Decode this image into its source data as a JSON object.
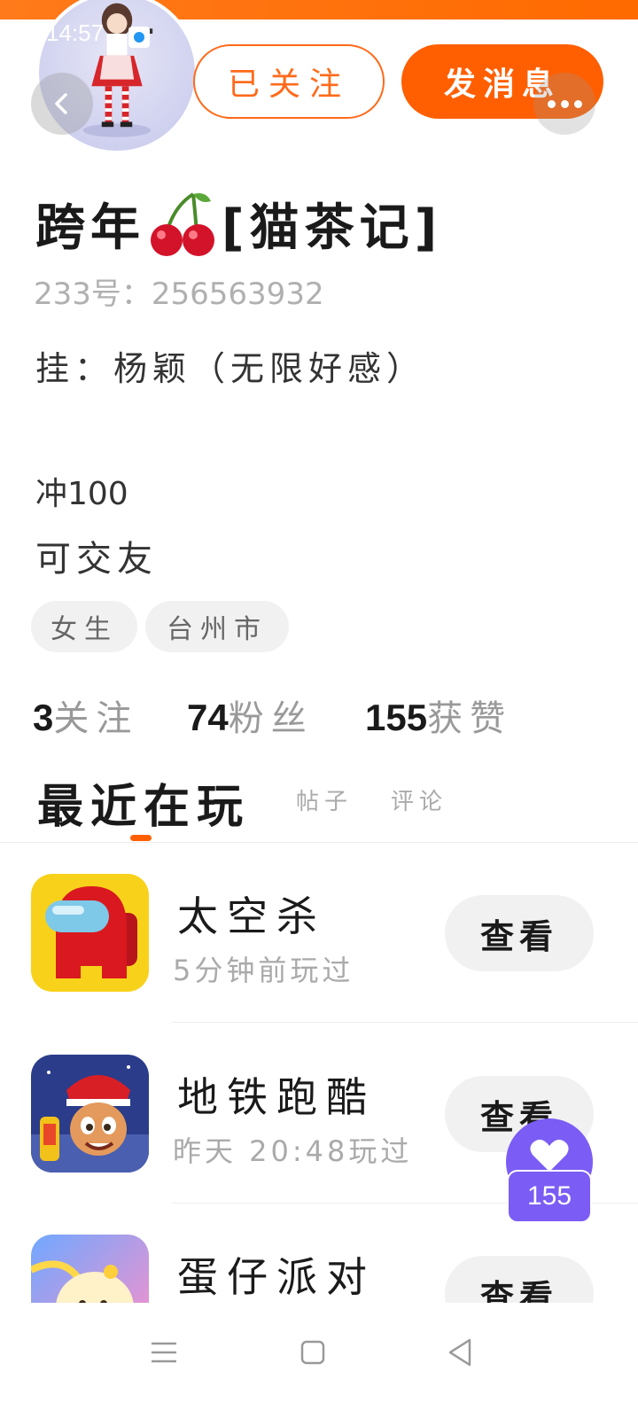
{
  "status_bar": {
    "time": "14:57"
  },
  "header": {
    "follow_label": "已关注",
    "message_label": "发消息"
  },
  "profile": {
    "name_prefix": "跨年",
    "name_suffix": "[猫茶记]",
    "uid_line": "233号：256563932",
    "bio_line_1": "挂：杨颖（无限好感）",
    "bio_line_2": "冲100",
    "bio_line_3": "可交友",
    "tags": [
      "女生",
      "台州市"
    ]
  },
  "stats": {
    "following": {
      "value": "3",
      "label": "关注"
    },
    "fans": {
      "value": "74",
      "label": "粉丝"
    },
    "likes": {
      "value": "155",
      "label": "获赞"
    }
  },
  "tabs": {
    "active": "最近在玩",
    "posts": "帖子",
    "comments": "评论"
  },
  "games": [
    {
      "name": "太空杀",
      "played": "5分钟前玩过",
      "button": "查看"
    },
    {
      "name": "地铁跑酷",
      "played": "昨天 20:48玩过",
      "button": "查看"
    },
    {
      "name": "蛋仔派对",
      "played": "",
      "button": "查看"
    }
  ],
  "like_float": {
    "count": "155"
  },
  "colors": {
    "accent": "#ff5f00",
    "like_purple": "#7b5cf4",
    "muted_text": "#aaaaaa"
  },
  "icons": {
    "back": "chevron-left-icon",
    "more": "more-dots-icon",
    "cherry": "cherry-emoji-icon",
    "heart": "heart-icon",
    "nav_menu": "menu-lines-icon",
    "nav_home": "square-home-icon",
    "nav_back": "triangle-back-icon"
  }
}
